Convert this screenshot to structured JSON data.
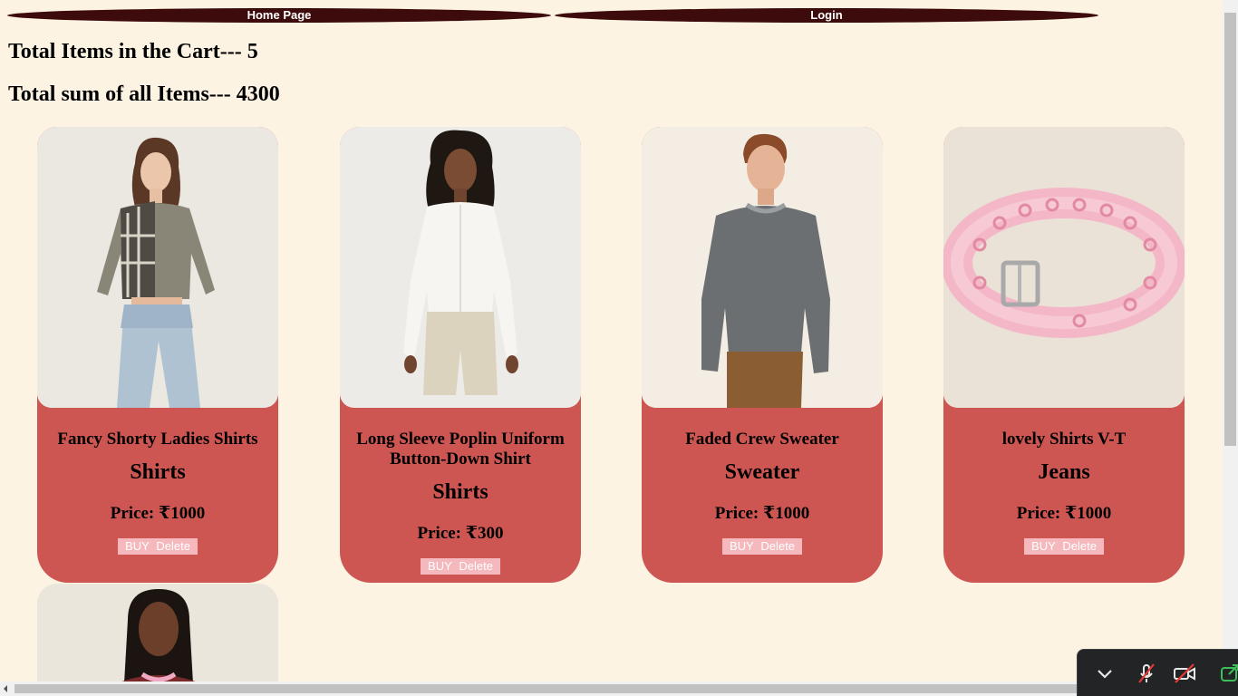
{
  "nav": {
    "home_label": "Home Page",
    "login_label": "Login"
  },
  "summary": {
    "total_items": "Total Items in the Cart--- 5",
    "total_sum": "Total sum of all Items--- 4300"
  },
  "products": [
    {
      "title": "Fancy Shorty Ladies Shirts",
      "category": "Shirts",
      "price": "Price: ₹1000",
      "buy_label": "BUY",
      "delete_label": "Delete"
    },
    {
      "title": "Long Sleeve Poplin Uniform Button-Down Shirt",
      "category": "Shirts",
      "price": "Price: ₹300",
      "buy_label": "BUY",
      "delete_label": "Delete"
    },
    {
      "title": "Faded Crew Sweater",
      "category": "Sweater",
      "price": "Price: ₹1000",
      "buy_label": "BUY",
      "delete_label": "Delete"
    },
    {
      "title": "lovely Shirts V-T",
      "category": "Jeans",
      "price": "Price: ₹1000",
      "buy_label": "BUY",
      "delete_label": "Delete"
    }
  ],
  "colors": {
    "background": "#fdf3e2",
    "nav": "#3e0b0c",
    "card": "#cd5652",
    "button": "#f5b8bd"
  },
  "call_toolbar": {
    "icons": [
      "chevron-down-icon",
      "mic-muted-icon",
      "camera-off-icon",
      "share-screen-icon"
    ]
  }
}
